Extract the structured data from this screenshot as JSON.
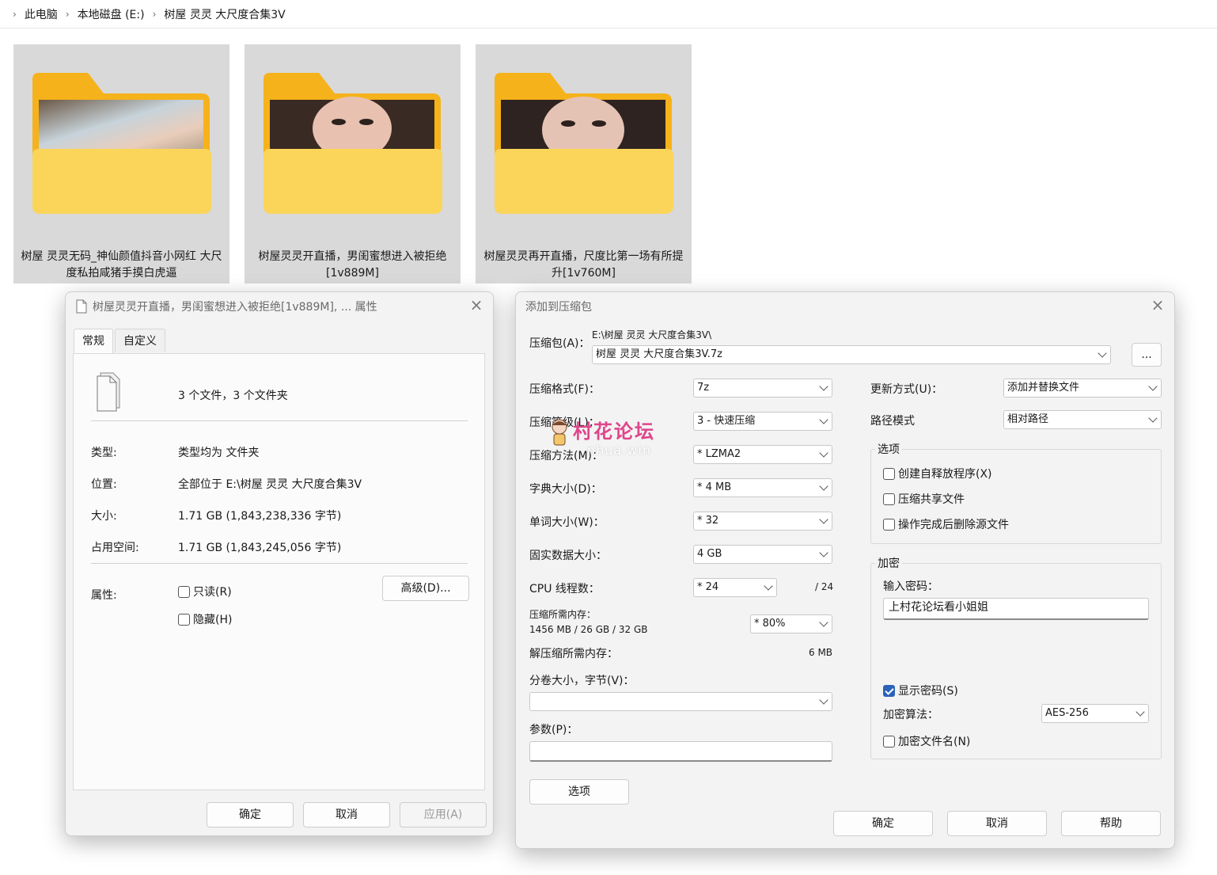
{
  "explorer": {
    "breadcrumb": [
      "此电脑",
      "本地磁盘 (E:)",
      "树屋 灵灵 大尺度合集3V"
    ],
    "folders": [
      {
        "name": "树屋 灵灵无码_神仙颜值抖音小网红 大尺度私拍咸猪手摸白虎逼"
      },
      {
        "name": "树屋灵灵开直播，男闺蜜想进入被拒绝[1v889M]"
      },
      {
        "name": "树屋灵灵再开直播，尺度比第一场有所提升[1v760M]"
      }
    ]
  },
  "properties": {
    "title": "树屋灵灵开直播，男闺蜜想进入被拒绝[1v889M], ... 属性",
    "tabs": [
      "常规",
      "自定义"
    ],
    "summary": "3 个文件，3 个文件夹",
    "rows": [
      {
        "label": "类型:",
        "value": "类型均为 文件夹"
      },
      {
        "label": "位置:",
        "value": "全部位于 E:\\树屋 灵灵 大尺度合集3V"
      },
      {
        "label": "大小:",
        "value": "1.71 GB (1,843,238,336 字节)"
      },
      {
        "label": "占用空间:",
        "value": "1.71 GB (1,843,245,056 字节)"
      }
    ],
    "attributes_label": "属性:",
    "readonly_label": "只读(R)",
    "hidden_label": "隐藏(H)",
    "advanced_button": "高级(D)...",
    "ok_button": "确定",
    "cancel_button": "取消",
    "apply_button": "应用(A)"
  },
  "compress": {
    "title": "添加到压缩包",
    "archive_label": "压缩包(A)：",
    "archive_dir": "E:\\树屋 灵灵 大尺度合集3V\\",
    "archive_name": "树屋 灵灵 大尺度合集3V.7z",
    "browse_button": "...",
    "format_label": "压缩格式(F)：",
    "format_value": "7z",
    "level_label": "压缩等级(L)：",
    "level_value": "3 - 快速压缩",
    "method_label": "压缩方法(M)：",
    "method_value": "* LZMA2",
    "dict_label": "字典大小(D)：",
    "dict_value": "* 4 MB",
    "word_label": "单词大小(W)：",
    "word_value": "* 32",
    "solid_label": "固实数据大小：",
    "solid_value": "4 GB",
    "cpu_label": "CPU 线程数：",
    "cpu_value": "* 24",
    "cpu_total": "/ 24",
    "mem_label": "压缩所需内存：",
    "mem_detail": "1456 MB / 26 GB / 32 GB",
    "mem_value": "* 80%",
    "decomp_label": "解压缩所需内存：",
    "decomp_value": "6 MB",
    "volume_label": "分卷大小，字节(V)：",
    "volume_value": "",
    "params_label": "参数(P)：",
    "params_value": "",
    "options_button": "选项",
    "update_label": "更新方式(U)：",
    "update_value": "添加并替换文件",
    "path_label": "路径模式",
    "path_value": "相对路径",
    "options_group": "选项",
    "opt_sfx": "创建自释放程序(X)",
    "opt_shared": "压缩共享文件",
    "opt_delete": "操作完成后删除源文件",
    "encrypt_group": "加密",
    "password_label": "输入密码：",
    "password_value": "上村花论坛看小姐姐",
    "show_password": "显示密码(S)",
    "enc_method_label": "加密算法：",
    "enc_method_value": "AES-256",
    "encrypt_names": "加密文件名(N)",
    "ok_button": "确定",
    "cancel_button": "取消",
    "help_button": "帮助"
  },
  "watermark": {
    "text": "村花论坛",
    "sub": "nhua.win"
  },
  "colors": {
    "folder_back": "#f6b21a",
    "folder_front": "#fbd55a",
    "accent": "#2b63b8",
    "watermark": "#e0458a"
  }
}
